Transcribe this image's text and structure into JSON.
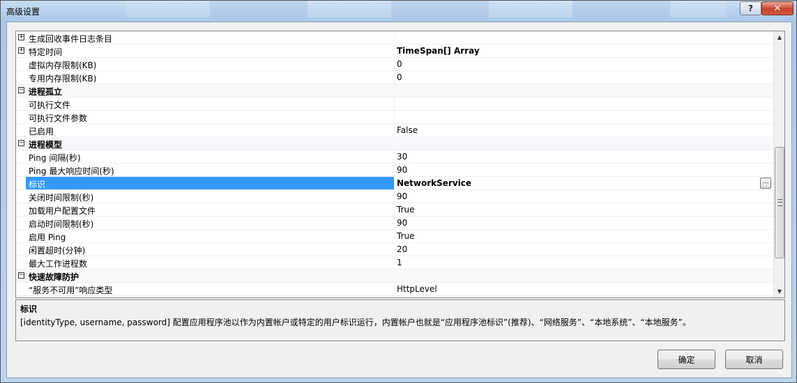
{
  "window": {
    "title": "高级设置",
    "help_label": "?",
    "close_label": "✕"
  },
  "grid": {
    "rows": [
      {
        "type": "item",
        "expander": "⊞",
        "name": "生成回收事件日志条目",
        "value": ""
      },
      {
        "type": "item",
        "expander": "⊞",
        "name": "特定时间",
        "value": "TimeSpan[] Array",
        "bold_value": true
      },
      {
        "type": "item",
        "name": "虚拟内存限制(KB)",
        "value": "0"
      },
      {
        "type": "item",
        "name": "专用内存限制(KB)",
        "value": "0"
      },
      {
        "type": "category",
        "expander": "⊟",
        "name": "进程孤立"
      },
      {
        "type": "item",
        "name": "可执行文件",
        "value": ""
      },
      {
        "type": "item",
        "name": "可执行文件参数",
        "value": ""
      },
      {
        "type": "item",
        "name": "已启用",
        "value": "False"
      },
      {
        "type": "category",
        "expander": "⊟",
        "name": "进程模型"
      },
      {
        "type": "item",
        "name": "Ping 间隔(秒)",
        "value": "30"
      },
      {
        "type": "item",
        "name": "Ping 最大响应时间(秒)",
        "value": "90"
      },
      {
        "type": "item",
        "name": "标识",
        "value": "NetworkService",
        "bold_value": true,
        "selected": true,
        "ellipsis": "..."
      },
      {
        "type": "item",
        "name": "关闭时间限制(秒)",
        "value": "90"
      },
      {
        "type": "item",
        "name": "加载用户配置文件",
        "value": "True"
      },
      {
        "type": "item",
        "name": "启动时间限制(秒)",
        "value": "90"
      },
      {
        "type": "item",
        "name": "启用 Ping",
        "value": "True"
      },
      {
        "type": "item",
        "name": "闲置超时(分钟)",
        "value": "20"
      },
      {
        "type": "item",
        "name": "最大工作进程数",
        "value": "1"
      },
      {
        "type": "category",
        "expander": "⊟",
        "name": "快速故障防护"
      },
      {
        "type": "item",
        "name": "“服务不可用”响应类型",
        "value": "HttpLevel"
      }
    ]
  },
  "help": {
    "title": "标识",
    "description": "[identityType, username, password] 配置应用程序池以作为内置帐户或特定的用户标识运行，内置帐户也就是“应用程序池标识”(推荐)、“网络服务”、“本地系统”、“本地服务”。"
  },
  "buttons": {
    "ok": "确定",
    "cancel": "取消"
  }
}
